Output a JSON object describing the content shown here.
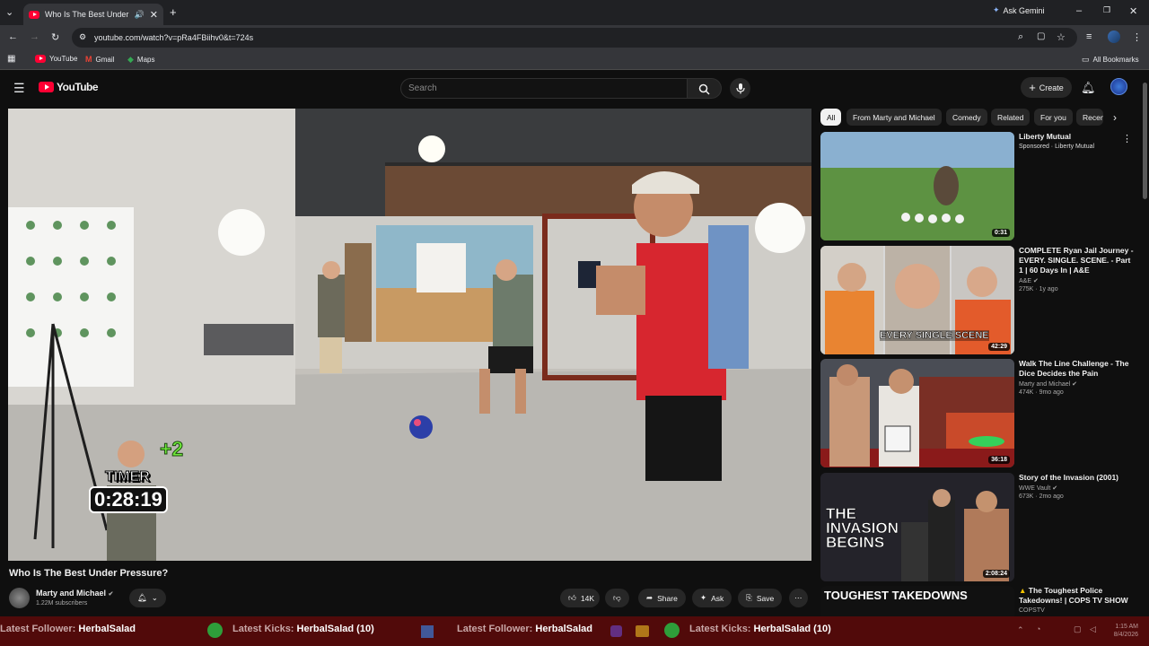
{
  "browser": {
    "tab_title": "Who Is The Best Under Pre",
    "url": "youtube.com/watch?v=pRa4FBiihv0&t=724s",
    "ask_gemini": "Ask Gemini",
    "bookmarks": [
      "YouTube",
      "Gmail",
      "Maps"
    ],
    "all_bookmarks": "All Bookmarks"
  },
  "youtube": {
    "logo_text": "YouTube",
    "search_placeholder": "Search",
    "create_label": "Create"
  },
  "video": {
    "title": "Who Is The Best Under Pressure?",
    "channel": "Marty and Michael",
    "subscribers": "1.22M subscribers",
    "likes": "14K",
    "share": "Share",
    "ask": "Ask",
    "save": "Save",
    "overlay_timer_label": "TIMER",
    "overlay_timer_value": "0:28:19",
    "overlay_bonus": "+2"
  },
  "chips": [
    "All",
    "From Marty and Michael",
    "Comedy",
    "Related",
    "For you",
    "Recen"
  ],
  "recommendations": [
    {
      "title": "Liberty Mutual",
      "channel": "Sponsored · Liberty Mutual",
      "meta": "",
      "duration": "0:31"
    },
    {
      "title": "COMPLETE Ryan Jail Journey - EVERY. SINGLE. SCENE. - Part 1 | 60 Days In | A&E",
      "channel": "A&E",
      "meta": "275K · 1y ago",
      "duration": "42:29",
      "thumb_text": "EVERY SINGLE SCENE"
    },
    {
      "title": "Walk The Line Challenge - The Dice Decides the Pain",
      "channel": "Marty and Michael",
      "meta": "474K · 9mo ago",
      "duration": "36:18"
    },
    {
      "title": "Story of the Invasion (2001)",
      "channel": "WWE Vault",
      "meta": "673K · 2mo ago",
      "duration": "2:08:24",
      "thumb_text": "THE INVASION BEGINS"
    },
    {
      "title": "The Toughest Police Takedowns! | COPS TV SHOW",
      "channel": "COPSTV",
      "meta": "",
      "thumb_text": "TOUGHEST TAKEDOWNS"
    }
  ],
  "ticker": [
    {
      "label": "Latest Follower:",
      "value": "HerbalSalad"
    },
    {
      "label": "Latest Kicks:",
      "value": "HerbalSalad (10)"
    },
    {
      "label": "Latest Follower:",
      "value": "HerbalSalad"
    },
    {
      "label": "Latest Kicks:",
      "value": "HerbalSalad (10)"
    }
  ],
  "clock": {
    "time": "1:15 AM",
    "date": "8/4/2026"
  },
  "colors": {
    "accent": "#ff0033",
    "ticker_bg": "#510a0a",
    "background": "#0f0f0f"
  }
}
